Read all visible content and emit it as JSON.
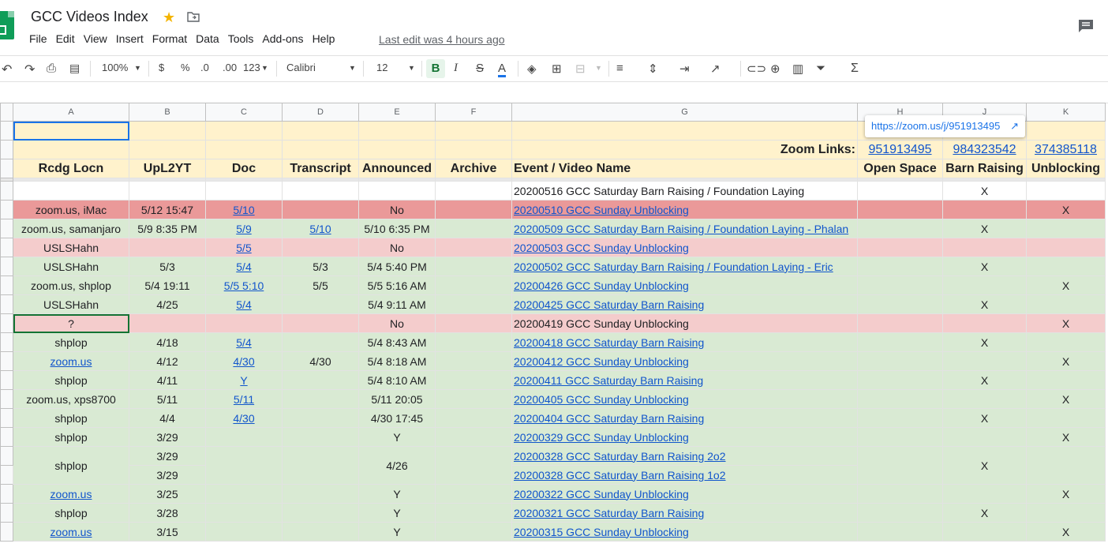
{
  "doc": {
    "title": "GCC Videos Index",
    "last_edit": "Last edit was 4 hours ago"
  },
  "menu": [
    "File",
    "Edit",
    "View",
    "Insert",
    "Format",
    "Data",
    "Tools",
    "Add-ons",
    "Help"
  ],
  "toolbar": {
    "zoom": "100%",
    "currency": "$",
    "percent": "%",
    "dec_less": ".0",
    "dec_more": ".00",
    "format_more": "123",
    "font": "Calibri",
    "font_size": "12",
    "bold": "B",
    "italic": "I",
    "strike": "S",
    "text_color": "A"
  },
  "col_headers": [
    "A",
    "B",
    "C",
    "D",
    "E",
    "F",
    "G",
    "H",
    "J",
    "K"
  ],
  "tooltip": {
    "url": "https://zoom.us/j/951913495"
  },
  "zoom_row": {
    "label": "Zoom Links:",
    "h": "951913495",
    "j": "984323542",
    "k": "374385118"
  },
  "header_row": [
    "Rcdg Locn",
    "UpL2YT",
    "Doc",
    "Transcript",
    "Announced",
    "Archive",
    "Event / Video Name",
    "Open Space",
    "Barn Raising",
    "Unblocking"
  ],
  "rows": [
    {
      "a": "",
      "b": "",
      "c": "",
      "d": "",
      "e": "",
      "g": "20200516 GCC Saturday Barn Raising / Foundation Laying",
      "j": "X",
      "k": ""
    },
    {
      "a": "zoom.us, iMac",
      "b": "5/12 15:47",
      "c": "5/10",
      "d": "",
      "e": "No",
      "g": "20200510 GCC Sunday Unblocking",
      "j": "",
      "k": "X"
    },
    {
      "a": "zoom.us, samanjaro",
      "b": "5/9 8:35 PM",
      "c": "5/9",
      "d": "5/10",
      "e": "5/10 6:35 PM",
      "g": "20200509 GCC Saturday Barn Raising / Foundation Laying - Phalan",
      "j": "X",
      "k": ""
    },
    {
      "a": "USLSHahn",
      "b": "",
      "c": "5/5",
      "d": "",
      "e": "No",
      "g": "20200503 GCC Sunday Unblocking",
      "j": "",
      "k": ""
    },
    {
      "a": "USLSHahn",
      "b": "5/3",
      "c": "5/4",
      "d": "5/3",
      "e": "5/4 5:40 PM",
      "g": "20200502 GCC Saturday Barn Raising / Foundation Laying - Eric",
      "j": "X",
      "k": ""
    },
    {
      "a": "zoom.us, shplop",
      "b": "5/4 19:11",
      "c": "5/5 5:10",
      "d": "5/5",
      "e": "5/5 5:16 AM",
      "g": "20200426 GCC Sunday Unblocking",
      "j": "",
      "k": "X"
    },
    {
      "a": "USLSHahn",
      "b": "4/25",
      "c": "5/4",
      "d": "",
      "e": "5/4 9:11 AM",
      "g": "20200425 GCC Saturday Barn Raising",
      "j": "X",
      "k": ""
    },
    {
      "a": "?",
      "b": "",
      "c": "",
      "d": "",
      "e": "No",
      "g": "20200419 GCC Sunday Unblocking",
      "j": "",
      "k": "X"
    },
    {
      "a": "shplop",
      "b": "4/18",
      "c": "5/4",
      "d": "",
      "e": "5/4 8:43 AM",
      "g": "20200418 GCC Saturday Barn Raising",
      "j": "X",
      "k": ""
    },
    {
      "a": "zoom.us",
      "b": "4/12",
      "c": "4/30",
      "d": "4/30",
      "e": "5/4 8:18 AM",
      "g": "20200412 GCC Sunday Unblocking",
      "j": "",
      "k": "X"
    },
    {
      "a": "shplop",
      "b": "4/11",
      "c": "Y",
      "d": "",
      "e": "5/4 8:10 AM",
      "g": "20200411 GCC Saturday Barn Raising",
      "j": "X",
      "k": ""
    },
    {
      "a": "zoom.us, xps8700",
      "b": "5/11",
      "c": "5/11",
      "d": "",
      "e": "5/11 20:05",
      "g": "20200405 GCC Sunday Unblocking",
      "j": "",
      "k": "X"
    },
    {
      "a": "shplop",
      "b": "4/4",
      "c": "4/30",
      "d": "",
      "e": "4/30 17:45",
      "g": "20200404 GCC Saturday Barn Raising",
      "j": "X",
      "k": ""
    },
    {
      "a": "shplop",
      "b": "3/29",
      "c": "",
      "d": "",
      "e": "Y",
      "g": "20200329 GCC Sunday Unblocking",
      "j": "",
      "k": "X"
    },
    {
      "a": "shplop",
      "b": "3/29",
      "c": "",
      "d": "",
      "e": "4/26",
      "g": "20200328 GCC Saturday Barn Raising 2o2",
      "j": "X",
      "k": ""
    },
    {
      "a": "",
      "b": "3/29",
      "c": "",
      "d": "",
      "e": "",
      "g": "20200328 GCC Saturday Barn Raising 1o2",
      "j": "",
      "k": ""
    },
    {
      "a": "zoom.us",
      "b": "3/25",
      "c": "",
      "d": "",
      "e": "Y",
      "g": "20200322 GCC Sunday Unblocking",
      "j": "",
      "k": "X"
    },
    {
      "a": "shplop",
      "b": "3/28",
      "c": "",
      "d": "",
      "e": "Y",
      "g": "20200321 GCC Saturday Barn Raising",
      "j": "X",
      "k": ""
    },
    {
      "a": "zoom.us",
      "b": "3/15",
      "c": "",
      "d": "",
      "e": "Y",
      "g": "20200315 GCC Sunday Unblocking",
      "j": "",
      "k": "X"
    }
  ]
}
